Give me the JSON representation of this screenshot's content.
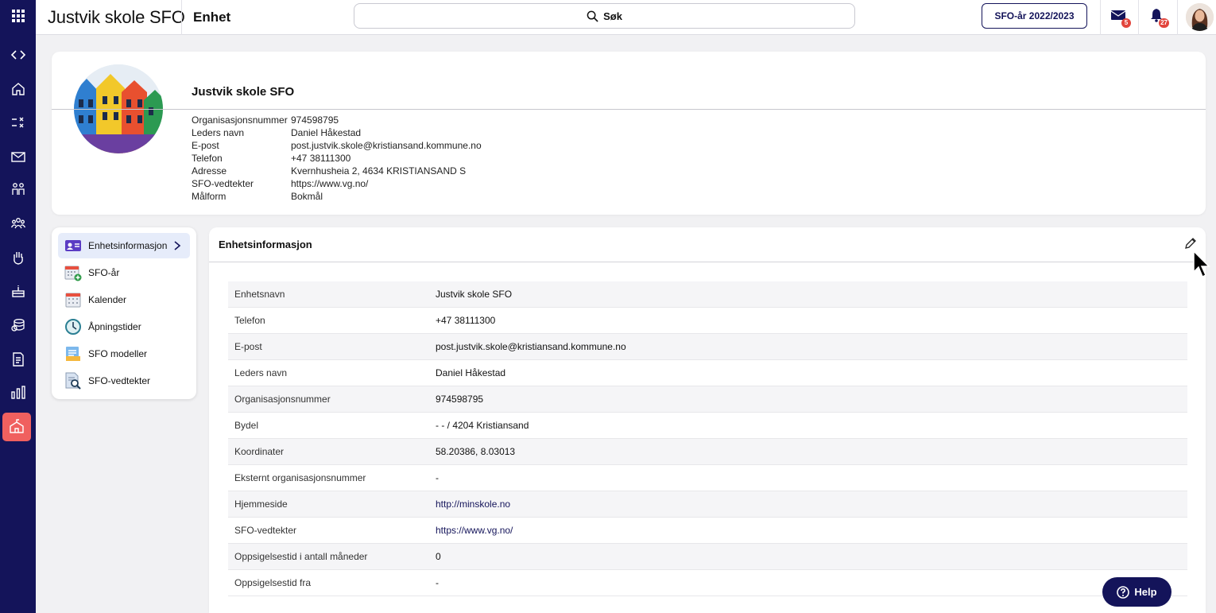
{
  "app": {
    "brand": "Justvik skole SFO",
    "page_title": "Enhet"
  },
  "search": {
    "label": "Søk"
  },
  "year_button": "SFO-år 2022/2023",
  "notifications": {
    "mail_count": "5",
    "bell_count": "27"
  },
  "rail": {
    "icons": [
      "apps-grid-icon",
      "code-icon",
      "home-icon",
      "tasks-icon",
      "mail-icon",
      "children-icon",
      "groups-icon",
      "hand-icon",
      "cake-icon",
      "coins-icon",
      "document-icon",
      "chart-icon",
      "school-icon"
    ],
    "active": "school-icon"
  },
  "profile": {
    "name": "Justvik skole SFO",
    "fields": [
      {
        "label": "Organisasjonsnummer",
        "value": "974598795"
      },
      {
        "label": "Leders navn",
        "value": "Daniel Håkestad"
      },
      {
        "label": "E-post",
        "value": "post.justvik.skole@kristiansand.kommune.no"
      },
      {
        "label": "Telefon",
        "value": "+47 38111300"
      },
      {
        "label": "Adresse",
        "value": "Kvernhusheia 2, 4634 KRISTIANSAND S"
      },
      {
        "label": "SFO-vedtekter",
        "value": "https://www.vg.no/"
      },
      {
        "label": "Målform",
        "value": "Bokmål"
      }
    ]
  },
  "menu": {
    "items": [
      {
        "label": "Enhetsinformasjon",
        "icon": "id-card-icon",
        "active": true
      },
      {
        "label": "SFO-år",
        "icon": "calendar-add-icon",
        "active": false
      },
      {
        "label": "Kalender",
        "icon": "calendar-icon",
        "active": false
      },
      {
        "label": "Åpningstider",
        "icon": "clock-icon",
        "active": false
      },
      {
        "label": "SFO modeller",
        "icon": "list-icon",
        "active": false
      },
      {
        "label": "SFO-vedtekter",
        "icon": "document-search-icon",
        "active": false
      }
    ]
  },
  "panel": {
    "title": "Enhetsinformasjon",
    "rows": [
      {
        "label": "Enhetsnavn",
        "value": "Justvik skole SFO"
      },
      {
        "label": "Telefon",
        "value": "+47 38111300"
      },
      {
        "label": "E-post",
        "value": "post.justvik.skole@kristiansand.kommune.no"
      },
      {
        "label": "Leders navn",
        "value": "Daniel Håkestad"
      },
      {
        "label": "Organisasjonsnummer",
        "value": "974598795"
      },
      {
        "label": "Bydel",
        "value": "- - / 4204 Kristiansand"
      },
      {
        "label": "Koordinater",
        "value": "58.20386, 8.03013"
      },
      {
        "label": "Eksternt organisasjonsnummer",
        "value": "-"
      },
      {
        "label": "Hjemmeside",
        "value": "http://minskole.no"
      },
      {
        "label": "SFO-vedtekter",
        "value": "https://www.vg.no/"
      },
      {
        "label": "Oppsigelsestid i antall måneder",
        "value": "0"
      },
      {
        "label": "Oppsigelsestid fra",
        "value": "-"
      }
    ]
  },
  "help_label": "Help",
  "colors": {
    "navy": "#14145a",
    "accent_red": "#f0605f",
    "active_bg": "#e6ecfa"
  }
}
